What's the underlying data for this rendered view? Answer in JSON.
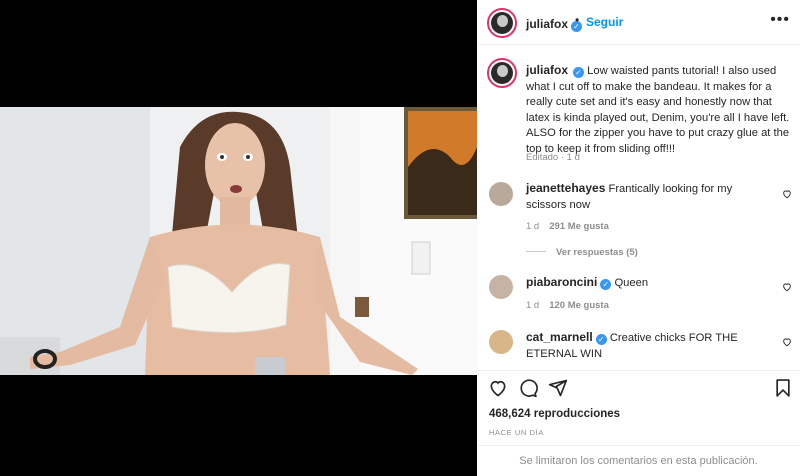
{
  "post": {
    "username": "juliafox",
    "separator": "•",
    "follow_label": "Seguir",
    "more_icon": "more-icon",
    "caption": "Low waisted pants tutorial! I also used what I cut off to make the bandeau. It makes for a really cute set and it's easy and honestly now that latex is kinda played out, Denim, you're all I have left. ALSO for the zipper you have to put crazy glue at the top to keep it from sliding off!!!",
    "edited": "Editado · 1 d"
  },
  "comments": [
    {
      "username": "jeanettehayes",
      "text": "Frantically looking for my scissors now",
      "age": "1 d",
      "likes": "291 Me gusta"
    },
    {
      "username": "piabaroncini",
      "text": "Queen",
      "age": "1 d",
      "likes": "120 Me gusta"
    },
    {
      "username": "cat_marnell",
      "text": "Creative chicks FOR THE ETERNAL WIN"
    }
  ],
  "replies_label": "Ver respuestas (5)",
  "stats": {
    "views": "468,624 reproducciones",
    "ago": "HACE UN DÍA"
  },
  "footer_text": "Se limitaron los comentarios en esta publicación.",
  "colors": {
    "accent": "#0095f6",
    "verified": "#3897f0",
    "story_ring": "#e1306c",
    "muted": "#8e8e8e"
  }
}
